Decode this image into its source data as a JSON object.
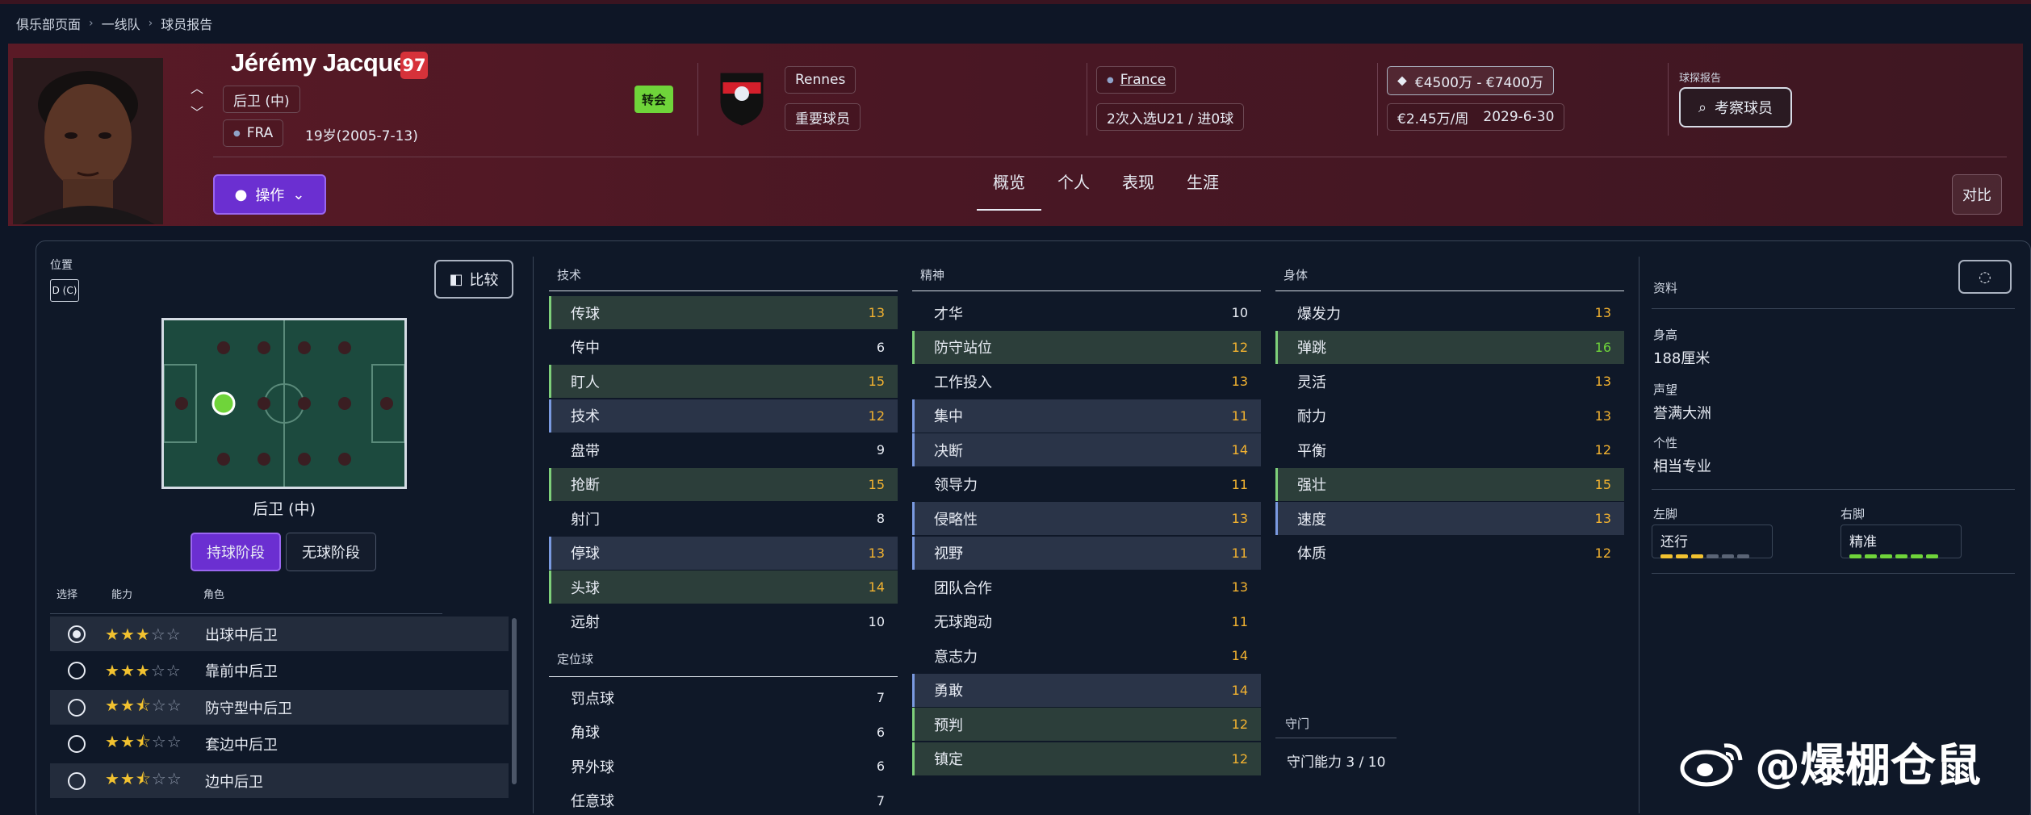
{
  "breadcrumbs": [
    "俱乐部页面",
    "一线队",
    "球员报告"
  ],
  "player": {
    "name": "Jérémy Jacquet",
    "rating": "97",
    "position": "后卫 (中)",
    "nation_code": "FRA",
    "age_dob": "19岁(2005-7-13)",
    "transfer_label": "转会"
  },
  "club": {
    "name": "Rennes",
    "status": "重要球员"
  },
  "nation": {
    "name": "France",
    "caps": "2次入选U21 / 进0球"
  },
  "value": {
    "range": "€4500万 - €7400万",
    "wage": "€2.45万/周",
    "contract": "2029-6-30"
  },
  "report": {
    "title": "球探报告",
    "button": "考察球员"
  },
  "actions": {
    "button": "操作",
    "compare_top": "对比"
  },
  "tabs": [
    "概览",
    "个人",
    "表现",
    "生涯"
  ],
  "position_panel": {
    "title": "位置",
    "badge": "D (C)",
    "compare": "比较",
    "pitch_label": "后卫 (中)",
    "phase_in": "持球阶段",
    "phase_out": "无球阶段",
    "col_select": "选择",
    "col_ability": "能力",
    "col_role": "角色"
  },
  "roles": [
    {
      "name": "出球中后卫",
      "stars": 3,
      "selected": true
    },
    {
      "name": "靠前中后卫",
      "stars": 3,
      "selected": false
    },
    {
      "name": "防守型中后卫",
      "stars": 2.5,
      "selected": false
    },
    {
      "name": "套边中后卫",
      "stars": 2.5,
      "selected": false
    },
    {
      "name": "边中后卫",
      "stars": 2.5,
      "selected": false
    }
  ],
  "technical": {
    "title": "技术",
    "rows": [
      {
        "name": "传球",
        "value": "13",
        "style": "hl",
        "color": "y"
      },
      {
        "name": "传中",
        "value": "6",
        "style": "pl",
        "color": "w"
      },
      {
        "name": "盯人",
        "value": "15",
        "style": "hl",
        "color": "y"
      },
      {
        "name": "技术",
        "value": "12",
        "style": "hb",
        "color": "y"
      },
      {
        "name": "盘带",
        "value": "9",
        "style": "pl",
        "color": "w"
      },
      {
        "name": "抢断",
        "value": "15",
        "style": "hl",
        "color": "y"
      },
      {
        "name": "射门",
        "value": "8",
        "style": "pl",
        "color": "w"
      },
      {
        "name": "停球",
        "value": "13",
        "style": "hb",
        "color": "y"
      },
      {
        "name": "头球",
        "value": "14",
        "style": "hl",
        "color": "y"
      },
      {
        "name": "远射",
        "value": "10",
        "style": "pl",
        "color": "w"
      }
    ]
  },
  "set_pieces": {
    "title": "定位球",
    "rows": [
      {
        "name": "罚点球",
        "value": "7",
        "style": "pl",
        "color": "w"
      },
      {
        "name": "角球",
        "value": "6",
        "style": "pl",
        "color": "w"
      },
      {
        "name": "界外球",
        "value": "6",
        "style": "pl",
        "color": "w"
      },
      {
        "name": "任意球",
        "value": "7",
        "style": "pl",
        "color": "w"
      }
    ]
  },
  "mental": {
    "title": "精神",
    "rows": [
      {
        "name": "才华",
        "value": "10",
        "style": "pl",
        "color": "w"
      },
      {
        "name": "防守站位",
        "value": "12",
        "style": "hl",
        "color": "y"
      },
      {
        "name": "工作投入",
        "value": "13",
        "style": "pl",
        "color": "y"
      },
      {
        "name": "集中",
        "value": "11",
        "style": "hb",
        "color": "y"
      },
      {
        "name": "决断",
        "value": "14",
        "style": "hb",
        "color": "y"
      },
      {
        "name": "领导力",
        "value": "11",
        "style": "pl",
        "color": "y"
      },
      {
        "name": "侵略性",
        "value": "13",
        "style": "hb",
        "color": "y"
      },
      {
        "name": "视野",
        "value": "11",
        "style": "hb",
        "color": "y"
      },
      {
        "name": "团队合作",
        "value": "13",
        "style": "pl",
        "color": "y"
      },
      {
        "name": "无球跑动",
        "value": "11",
        "style": "pl",
        "color": "y"
      },
      {
        "name": "意志力",
        "value": "14",
        "style": "pl",
        "color": "y"
      },
      {
        "name": "勇敢",
        "value": "14",
        "style": "hb",
        "color": "y"
      },
      {
        "name": "预判",
        "value": "12",
        "style": "hl",
        "color": "y"
      },
      {
        "name": "镇定",
        "value": "12",
        "style": "hl",
        "color": "y"
      }
    ]
  },
  "physical": {
    "title": "身体",
    "rows": [
      {
        "name": "爆发力",
        "value": "13",
        "style": "pl",
        "color": "y"
      },
      {
        "name": "弹跳",
        "value": "16",
        "style": "hl",
        "color": "g"
      },
      {
        "name": "灵活",
        "value": "13",
        "style": "pl",
        "color": "y"
      },
      {
        "name": "耐力",
        "value": "13",
        "style": "pl",
        "color": "y"
      },
      {
        "name": "平衡",
        "value": "12",
        "style": "pl",
        "color": "y"
      },
      {
        "name": "强壮",
        "value": "15",
        "style": "hl",
        "color": "y"
      },
      {
        "name": "速度",
        "value": "13",
        "style": "hb",
        "color": "y"
      },
      {
        "name": "体质",
        "value": "12",
        "style": "pl",
        "color": "y"
      }
    ]
  },
  "goalkeeping": {
    "title": "守门",
    "text": "守门能力 3 / 10"
  },
  "info": {
    "title": "资料",
    "height_label": "身高",
    "height": "188厘米",
    "reputation_label": "声望",
    "reputation": "誉满大洲",
    "personality_label": "个性",
    "personality": "相当专业",
    "left_foot_label": "左脚",
    "left_foot": "还行",
    "left_foot_level": 3,
    "right_foot_label": "右脚",
    "right_foot": "精准",
    "right_foot_level": 6
  },
  "colors": {
    "accent": "#6b2fd1",
    "rating": "#d6323a",
    "green": "#6fd43a",
    "yellow": "#f2b230"
  },
  "watermark": "@爆棚仓鼠"
}
